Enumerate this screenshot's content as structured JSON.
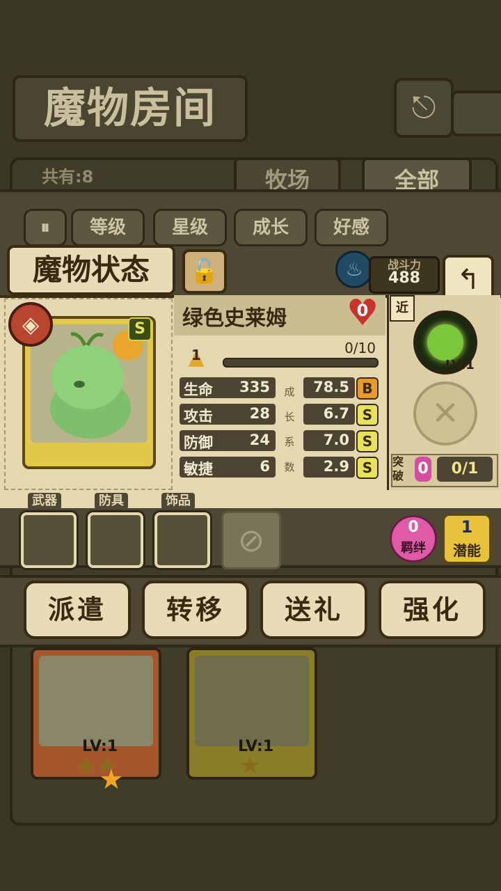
{
  "room": {
    "title": "魔物房间",
    "owned_label": "共有:8",
    "tabs": [
      "牧场",
      "全部"
    ],
    "back_icon": "return-icon",
    "list_cards": [
      {
        "level": "LV:1",
        "stars": "★★"
      },
      {
        "level": "LV:1",
        "stars": "★"
      }
    ]
  },
  "filters": [
    "等级",
    "星级",
    "成长",
    "好感"
  ],
  "status": {
    "title": "魔物状态",
    "power_label": "战斗力",
    "power_value": "488"
  },
  "monster": {
    "name": "绿色史莱姆",
    "affection": "0",
    "rank": "S",
    "stars": "★",
    "level": "1",
    "exp_text": "0/10",
    "exp_fraction": 0.0,
    "stats": [
      {
        "name": "生命",
        "value": "335",
        "growth": "78.5",
        "grade": "B"
      },
      {
        "name": "攻击",
        "value": "28",
        "growth": "6.7",
        "grade": "S"
      },
      {
        "name": "防御",
        "value": "24",
        "growth": "7.0",
        "grade": "S"
      },
      {
        "name": "敏捷",
        "value": "6",
        "growth": "2.9",
        "grade": "S"
      }
    ],
    "growth_labels": [
      "成",
      "长",
      "系",
      "数"
    ],
    "range": "近",
    "skill_level": "LV:1",
    "breakthrough_label": "突破",
    "breakthrough_value": "0",
    "breakthrough_progress": "0/1"
  },
  "equipment": {
    "slots": [
      "武器",
      "防具",
      "饰品"
    ],
    "bond_value": "0",
    "bond_label": "羁绊",
    "potential_value": "1",
    "potential_label": "潜能"
  },
  "actions": [
    "派遣",
    "转移",
    "送礼",
    "强化"
  ],
  "colors": {
    "grade_b": "#e89a2a",
    "grade_s": "#e8e25a",
    "accent_heart": "#c8332e"
  }
}
